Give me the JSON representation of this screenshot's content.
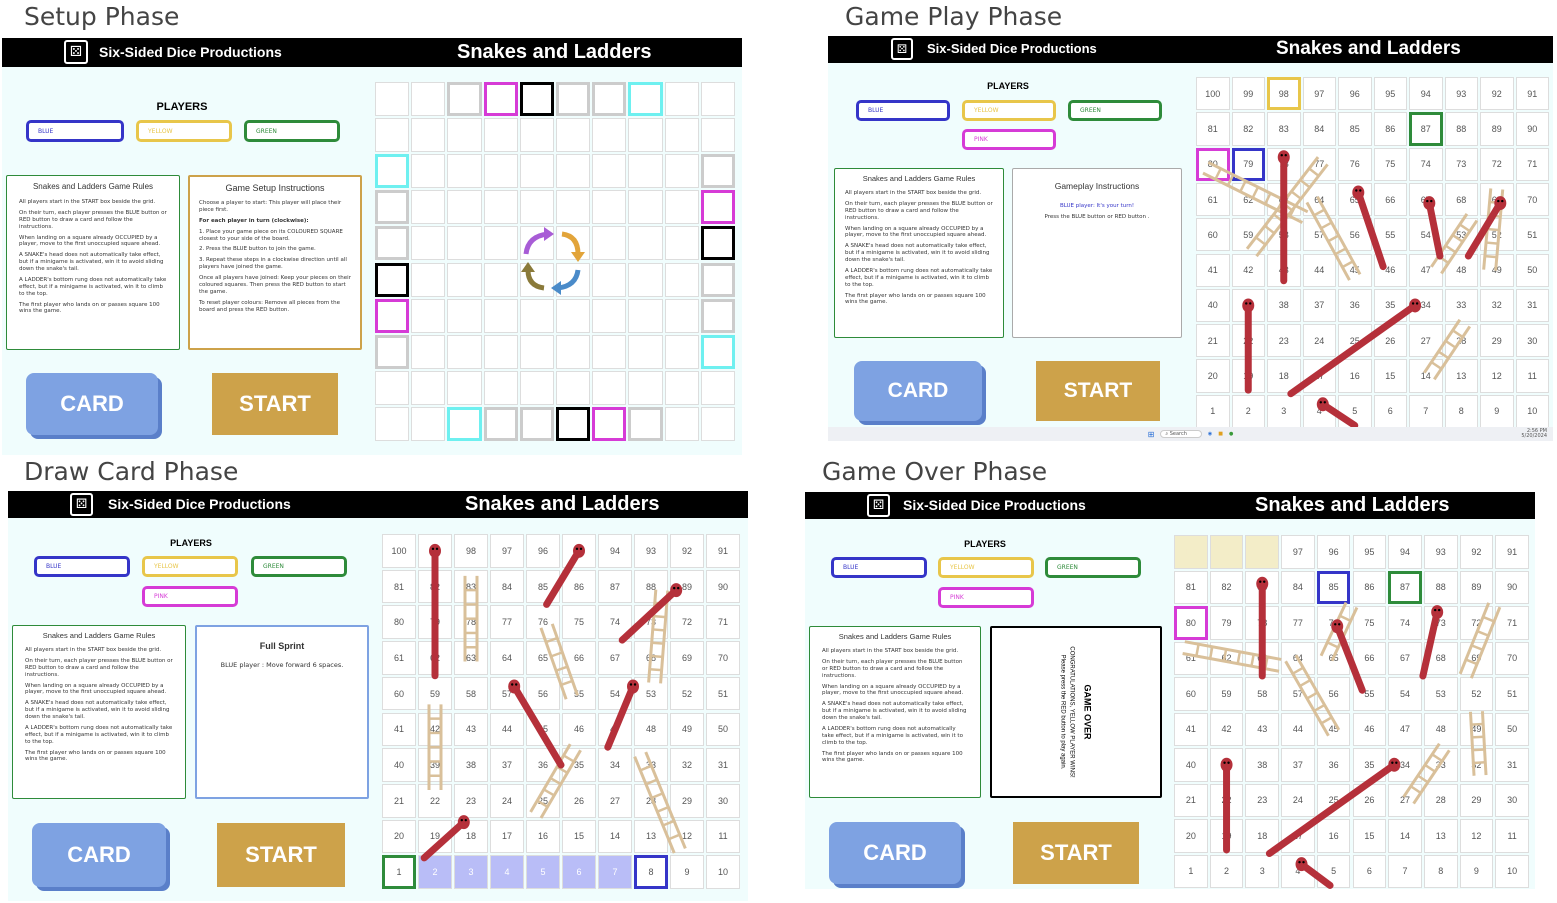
{
  "phases": {
    "setup": "Setup Phase",
    "play": "Game Play Phase",
    "draw": "Draw Card Phase",
    "over": "Game Over Phase"
  },
  "header": {
    "company": "Six-Sided Dice Productions",
    "game_title": "Snakes and Ladders"
  },
  "players": {
    "label": "PLAYERS",
    "blue": "BLUE",
    "yellow": "YELLOW",
    "green": "GREEN",
    "pink": "PINK"
  },
  "rules": {
    "title": "Snakes and Ladders Game Rules",
    "r1": "All players start in the START box beside the grid.",
    "r2": "On their turn, each player presses the BLUE button or RED button to draw a card and follow the instructions.",
    "r3": "When landing on a square already OCCUPIED by a player, move to the first unoccupied square ahead.",
    "r4": "A SNAKE's head does not automatically take effect, but if a minigame is activated, win it to avoid sliding down the snake's tail.",
    "r5": "A LADDER's bottom rung does not automatically take effect, but if a minigame is activated, win it to climb to the top.",
    "r6": "The first player who lands on or passes square 100 wins the game."
  },
  "setup_instr": {
    "title": "Game Setup Instructions",
    "s1": "Choose a player to start: This player will place their piece first.",
    "s2": "For each player in turn (clockwise):",
    "s3": "1. Place your game piece on its COLOURED SQUARE closest to your side of the board.",
    "s4": "2. Press the BLUE button to join the game.",
    "s5": "3. Repeat these steps in a clockwise direction until all players have joined the game.",
    "s6": "Once all players have joined: Keep your pieces on their coloured squares. Then press the RED button to start the game.",
    "s7": "To reset player colours: Remove all pieces from the board and press the RED button."
  },
  "gameplay_instr": {
    "title": "Gameplay Instructions",
    "line1": "BLUE player: It's your turn!",
    "line2": "Press the BLUE button or RED button ."
  },
  "draw_card": {
    "title": "Full Sprint",
    "text": "BLUE player : Move forward 6 spaces."
  },
  "game_over": {
    "title": "GAME OVER",
    "line1": "CONGRATULATIONS, YELLOW PLAYER WINS!",
    "line2": "Please press the RED button to play again."
  },
  "buttons": {
    "card": "CARD",
    "start": "START"
  },
  "taskbar": {
    "search": "Search",
    "time": "2:56 PM",
    "date": "5/20/2024"
  },
  "colors": {
    "blue": "#3535c8",
    "yellow": "#e8c64a",
    "green": "#2e8b3a",
    "pink": "#d63bd6",
    "cyan": "#6ef0f0",
    "snake": "#b5303a",
    "ladder": "#d9c09a"
  }
}
